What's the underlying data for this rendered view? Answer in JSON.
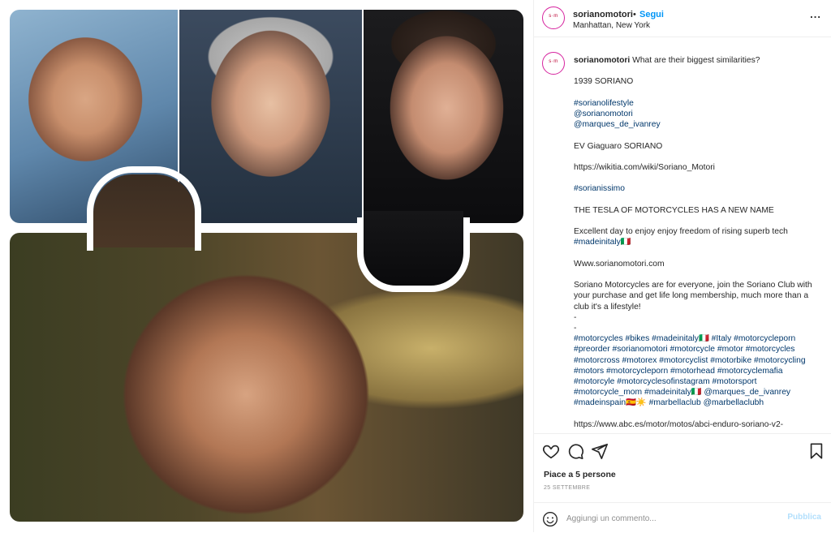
{
  "post": {
    "username": "sorianomotori",
    "separator": "•",
    "follow_label": "Segui",
    "location": "Manhattan, New York",
    "more_label": "..."
  },
  "caption": {
    "username": "sorianomotori",
    "first_line": "What are their biggest similarities?",
    "lines": [
      "1939 SORIANO",
      "",
      "#sorianolifestyle",
      "@sorianomotori",
      "@marques_de_ivanrey",
      "",
      "EV Giaguaro SORIANO",
      "",
      "https://wikitia.com/wiki/Soriano_Motori",
      "",
      "#sorianissimo",
      "",
      "THE TESLA OF MOTORCYCLES HAS A NEW NAME",
      "",
      "Excellent day to enjoy enjoy freedom of rising superb tech",
      "#madeinitaly🇮🇹",
      "",
      "Www.sorianomotori.com",
      "",
      "Soriano Motorcycles are for everyone, join the Soriano Club with",
      "your purchase and get life long membership, much more than a",
      "club it's a lifestyle!",
      "-",
      "-",
      "#motorcycles #bikes #madeinitaly🇮🇹 #Italy #motorcycleporn",
      "#preorder #sorianomotori #motorcycle #motor #motorcycles",
      "#motorcross #motorex #motorcyclist #motorbike #motorcycling",
      "#motors #motorcycleporn #motorhead #motorcyclemafia",
      "#motorcyle #motorcyclesofinstagram #motorsport",
      "#motorcycle_mom #madeinitaly🇮🇹 @marques_de_ivanrey",
      "#madeinspain🇪🇸☀️ #marbellaclub @marbellaclubh",
      "",
      "https://www.abc.es/motor/motos/abci-enduro-soriano-v2-"
    ]
  },
  "actions": {
    "likes_text": "Piace a 5 persone",
    "date_text": "25 SETTEMBRE",
    "comment_placeholder": "Aggiungi un commento...",
    "publish_label": "Pubblica",
    "icons": [
      "heart-icon",
      "comment-icon",
      "share-icon",
      "bookmark-icon",
      "emoji-icon"
    ]
  },
  "colors": {
    "link_blue": "#0095f6",
    "hashtag_navy": "#00376b",
    "muted_gray": "#8e8e8e",
    "publish_disabled": "#b2dffc"
  }
}
